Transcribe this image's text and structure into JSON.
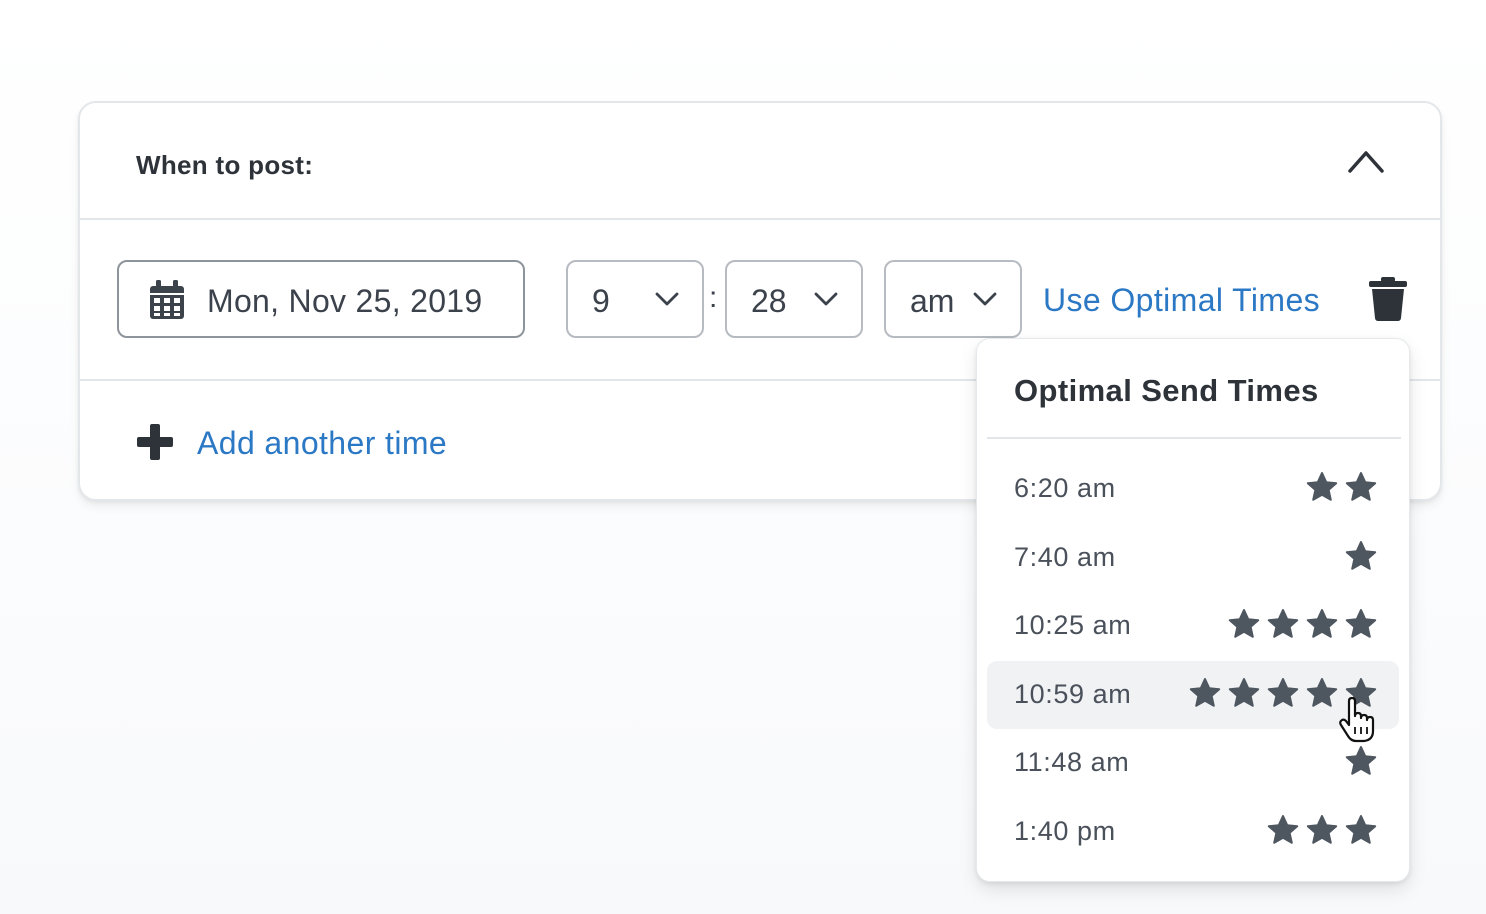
{
  "card": {
    "title": "When to post:",
    "collapse_icon": "chevron-up-icon"
  },
  "schedule": {
    "date": "Mon, Nov 25, 2019",
    "date_icon": "calendar-icon",
    "hour": "9",
    "separator": ":",
    "minute": "28",
    "ampm": "am",
    "optimal_link": "Use Optimal Times",
    "delete_icon": "trash-icon"
  },
  "add_time": {
    "icon": "plus-icon",
    "label": "Add another time"
  },
  "dropdown": {
    "title": "Optimal Send Times",
    "options": [
      {
        "time": "6:20 am",
        "stars": 2
      },
      {
        "time": "7:40 am",
        "stars": 1
      },
      {
        "time": "10:25 am",
        "stars": 4
      },
      {
        "time": "10:59 am",
        "stars": 5,
        "hovered": true
      },
      {
        "time": "11:48 am",
        "stars": 1
      },
      {
        "time": "1:40 pm",
        "stars": 3
      }
    ]
  },
  "colors": {
    "accent": "#2b78c5",
    "star": "#4e565f",
    "hover_bg": "#f0f2f4"
  }
}
